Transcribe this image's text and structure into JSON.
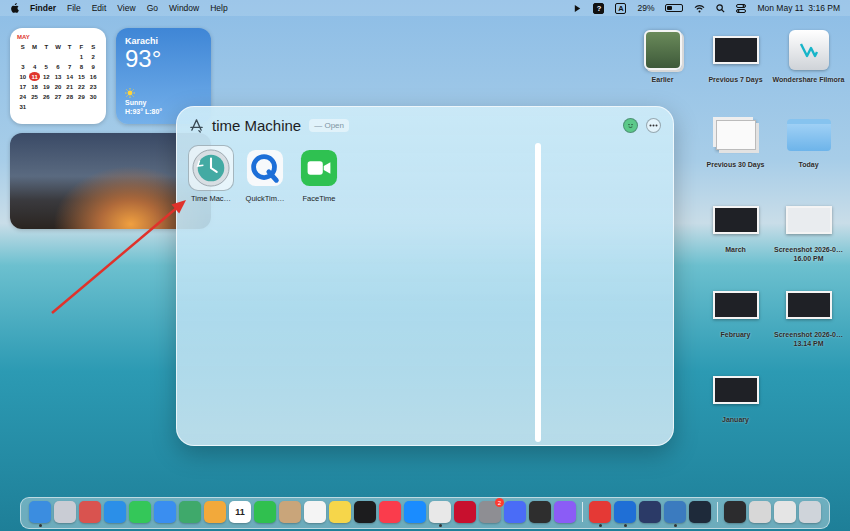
{
  "menu_bar": {
    "items": [
      {
        "label": "Finder",
        "active": true
      },
      {
        "label": "File",
        "active": false
      },
      {
        "label": "Edit",
        "active": false
      },
      {
        "label": "View",
        "active": false
      },
      {
        "label": "Go",
        "active": false
      },
      {
        "label": "Window",
        "active": false
      },
      {
        "label": "Help",
        "active": false
      }
    ],
    "status_glyphs": [
      {
        "text": "?",
        "kind": "filled"
      },
      {
        "text": "A",
        "kind": "outlined"
      }
    ],
    "battery": "29%",
    "battery_level": 0.29,
    "clock": "Mon May 11  3:16 PM"
  },
  "calendar_widget": {
    "month": "MAY",
    "weekdays": [
      "S",
      "M",
      "T",
      "W",
      "T",
      "F",
      "S"
    ],
    "weeks": [
      [
        "",
        "",
        "",
        "",
        "",
        "1",
        "2"
      ],
      [
        "3",
        "4",
        "5",
        "6",
        "7",
        "8",
        "9"
      ],
      [
        "10",
        "11",
        "12",
        "13",
        "14",
        "15",
        "16"
      ],
      [
        "17",
        "18",
        "19",
        "20",
        "21",
        "22",
        "23"
      ],
      [
        "24",
        "25",
        "26",
        "27",
        "28",
        "29",
        "30"
      ],
      [
        "31",
        "",
        "",
        "",
        "",
        "",
        ""
      ]
    ],
    "today": "11"
  },
  "weather_widget": {
    "city": "Karachi",
    "temperature": "93°",
    "condition": "Sunny",
    "range": "H:93° L:80°"
  },
  "search_window": {
    "query": "time Machine",
    "hint": "— Open",
    "results": [
      {
        "label": "Time Mac…",
        "kind": "time-machine",
        "selected": true
      },
      {
        "label": "QuickTim…",
        "kind": "quicktime",
        "selected": false
      },
      {
        "label": "FaceTime",
        "kind": "facetime",
        "selected": false
      }
    ]
  },
  "desktop_items": [
    {
      "label": "Earlier",
      "kind": "stack"
    },
    {
      "label": "Previous 7 Days",
      "kind": "screenshot"
    },
    {
      "label": "Wondershare Filmora",
      "kind": "app"
    },
    {
      "label": "Previous 30 Days",
      "kind": "documents"
    },
    {
      "label": "Today",
      "kind": "folder"
    },
    {
      "label": "March",
      "kind": "screenshot"
    },
    {
      "label": "Screenshot 2026-0…16.00 PM",
      "kind": "screenshot-light"
    },
    {
      "label": "February",
      "kind": "screenshot"
    },
    {
      "label": "Screenshot 2026-0…13.14 PM",
      "kind": "screenshot"
    },
    {
      "label": "January",
      "kind": "screenshot"
    }
  ],
  "dock": {
    "items": [
      {
        "kind": "app",
        "color": "#3b8de0",
        "running": true
      },
      {
        "kind": "app",
        "color": "#c9ccd4",
        "running": false
      },
      {
        "kind": "app",
        "color": "#d9534f",
        "running": false
      },
      {
        "kind": "app",
        "color": "#2b8fe8",
        "running": false
      },
      {
        "kind": "app",
        "color": "#34c759",
        "running": false
      },
      {
        "kind": "app",
        "color": "#3a8ef0",
        "running": false
      },
      {
        "kind": "app",
        "color": "#3fa96b",
        "running": false
      },
      {
        "kind": "app",
        "color": "#f2a93b",
        "running": false
      },
      {
        "kind": "calendar",
        "color": "#ffffff",
        "running": false,
        "text": "11"
      },
      {
        "kind": "app",
        "color": "#30c04f",
        "running": false
      },
      {
        "kind": "app",
        "color": "#c9a57a",
        "running": false
      },
      {
        "kind": "app",
        "color": "#f4f4f4",
        "running": false
      },
      {
        "kind": "app",
        "color": "#f6d64a",
        "running": false
      },
      {
        "kind": "app",
        "color": "#1c1c1e",
        "running": false
      },
      {
        "kind": "app",
        "color": "#fa3c4c",
        "running": false
      },
      {
        "kind": "app",
        "color": "#1a8cff",
        "running": false
      },
      {
        "kind": "app",
        "color": "#e8e8e8",
        "running": true
      },
      {
        "kind": "app",
        "color": "#c8102e",
        "running": false
      },
      {
        "kind": "app",
        "color": "#8e8e93",
        "running": false,
        "badge": "2"
      },
      {
        "kind": "app",
        "color": "#4a6cf7",
        "running": false
      },
      {
        "kind": "app",
        "color": "#2e2e2e",
        "running": false
      },
      {
        "kind": "app",
        "color": "#8b5cf6",
        "running": false
      },
      {
        "kind": "separator",
        "color": "#ffffff",
        "running": false
      },
      {
        "kind": "app",
        "color": "#e53935",
        "running": true
      },
      {
        "kind": "app",
        "color": "#1f6fd6",
        "running": true
      },
      {
        "kind": "app",
        "color": "#2b3a67",
        "running": false
      },
      {
        "kind": "app",
        "color": "#3b7bbf",
        "running": true
      },
      {
        "kind": "app",
        "color": "#1e2a3a",
        "running": false
      },
      {
        "kind": "separator",
        "color": "#ffffff",
        "running": false
      },
      {
        "kind": "app",
        "color": "#2c2c2e",
        "running": false
      },
      {
        "kind": "app",
        "color": "#d7d7d7",
        "running": false
      },
      {
        "kind": "app",
        "color": "#e5e5e5",
        "running": false
      },
      {
        "kind": "app",
        "color": "#cfd4da",
        "running": false
      }
    ]
  }
}
